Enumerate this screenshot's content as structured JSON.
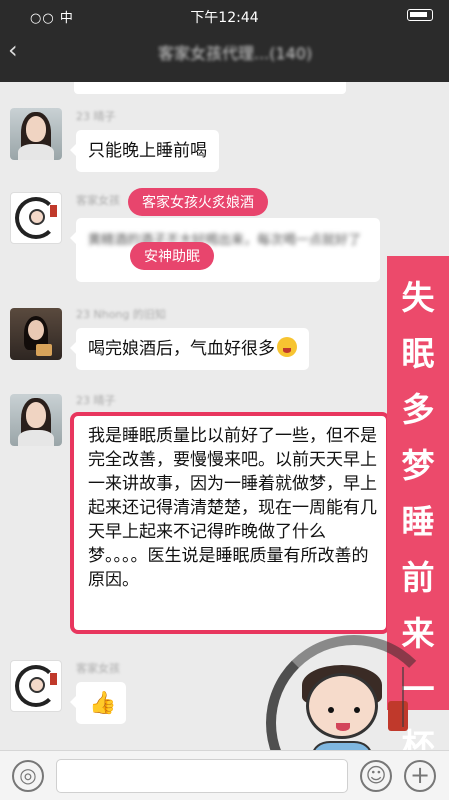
{
  "status_bar": {
    "carrier": "○○ 中",
    "time": "下午12:44"
  },
  "header": {
    "back": "‹",
    "title": "客家女孩代理...(140)"
  },
  "messages": [
    {
      "nick": "23 晴子",
      "text": "只能晚上睡前喝"
    },
    {
      "nick": "客家女孩",
      "text": "黄精酒的酒子不大好喝出来，每次喝一点就好了"
    },
    {
      "nick": "23 Nhong 的旧知",
      "text": "喝完娘酒后，气血好很多"
    },
    {
      "nick": "23 晴子",
      "text": "我是睡眠质量比以前好了一些，但不是完全改善，要慢慢来吧。以前天天早上一来讲故事，因为一睡着就做梦，早上起来还记得清清楚楚，现在一周能有几天早上起来不记得昨晚做了什么梦。。。。医生说是睡眠质量有所改善的原因。"
    },
    {
      "nick": "客家女孩",
      "text": "👍"
    }
  ],
  "tags": {
    "tag1": "客家女孩火炙娘酒",
    "tag2": "安神助眠"
  },
  "side_banner": [
    "失",
    "眠",
    "多",
    "梦",
    "睡",
    "前",
    "来",
    "一",
    "杯"
  ],
  "colors": {
    "accent": "#e8456d",
    "banner": "#ec4a6b",
    "chat_bg": "#ebebeb",
    "topbar": "#2b2b2b"
  },
  "input_bar": {
    "voice_icon": "◎",
    "emoji_icon": "☺",
    "plus_icon": "+"
  }
}
